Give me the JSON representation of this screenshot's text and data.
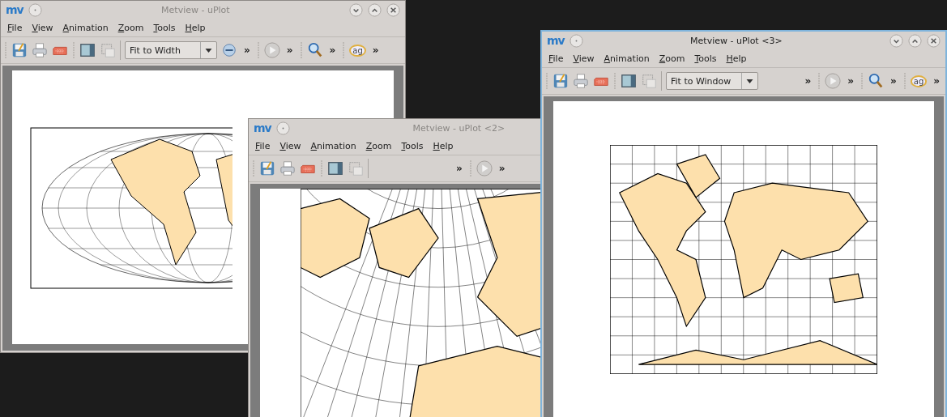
{
  "windows": [
    {
      "title": "Metview - uPlot",
      "active": false,
      "logo": "mv",
      "window_buttons": true,
      "menu": [
        "File",
        "View",
        "Animation",
        "Zoom",
        "Tools",
        "Help"
      ],
      "toolbar": [
        {
          "kind": "grip"
        },
        {
          "kind": "save"
        },
        {
          "kind": "print"
        },
        {
          "kind": "export"
        },
        {
          "kind": "grip"
        },
        {
          "kind": "sidebar"
        },
        {
          "kind": "select"
        },
        {
          "kind": "separator"
        },
        {
          "kind": "combo",
          "value": "Fit to Width"
        },
        {
          "kind": "zoom-out"
        },
        {
          "kind": "more",
          "label": "»"
        },
        {
          "kind": "grip"
        },
        {
          "kind": "play"
        },
        {
          "kind": "more",
          "label": "»"
        },
        {
          "kind": "grip"
        },
        {
          "kind": "magnifier"
        },
        {
          "kind": "more",
          "label": "»"
        },
        {
          "kind": "grip"
        },
        {
          "kind": "tag",
          "label": "ag"
        },
        {
          "kind": "more",
          "label": "»"
        }
      ],
      "map": {
        "kind": "hammer"
      }
    },
    {
      "title": "Metview - uPlot <2>",
      "active": false,
      "logo": "mv",
      "window_buttons": false,
      "menu": [
        "File",
        "View",
        "Animation",
        "Zoom",
        "Tools",
        "Help"
      ],
      "toolbar": [
        {
          "kind": "grip"
        },
        {
          "kind": "save"
        },
        {
          "kind": "print"
        },
        {
          "kind": "export"
        },
        {
          "kind": "grip"
        },
        {
          "kind": "sidebar"
        },
        {
          "kind": "select"
        },
        {
          "kind": "separator"
        },
        {
          "kind": "spacer"
        },
        {
          "kind": "more",
          "label": "»"
        },
        {
          "kind": "grip"
        },
        {
          "kind": "play"
        },
        {
          "kind": "more",
          "label": "»"
        }
      ],
      "map": {
        "kind": "polar"
      }
    },
    {
      "title": "Metview - uPlot <3>",
      "active": true,
      "logo": "mv",
      "window_buttons": true,
      "menu": [
        "File",
        "View",
        "Animation",
        "Zoom",
        "Tools",
        "Help"
      ],
      "toolbar": [
        {
          "kind": "grip"
        },
        {
          "kind": "save"
        },
        {
          "kind": "print"
        },
        {
          "kind": "export"
        },
        {
          "kind": "grip"
        },
        {
          "kind": "sidebar"
        },
        {
          "kind": "select"
        },
        {
          "kind": "separator"
        },
        {
          "kind": "combo",
          "value": "Fit to Window"
        },
        {
          "kind": "spacer"
        },
        {
          "kind": "more",
          "label": "»"
        },
        {
          "kind": "grip"
        },
        {
          "kind": "play"
        },
        {
          "kind": "more",
          "label": "»"
        },
        {
          "kind": "grip"
        },
        {
          "kind": "magnifier"
        },
        {
          "kind": "more",
          "label": "»"
        },
        {
          "kind": "grip"
        },
        {
          "kind": "tag",
          "label": "ag"
        },
        {
          "kind": "more",
          "label": "»"
        }
      ],
      "map": {
        "kind": "mercator"
      }
    }
  ]
}
